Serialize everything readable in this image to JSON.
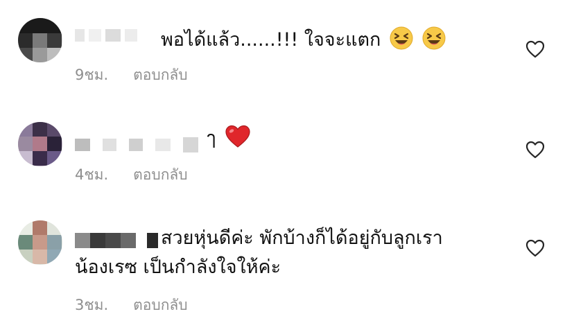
{
  "comments": [
    {
      "text": "พอได้แล้ว......!!! ใจจะแตก",
      "emoji": [
        "laughing-emoji",
        "laughing-emoji"
      ],
      "time": "9ชม.",
      "reply_label": "ตอบกลับ",
      "like_icon": "heart-outline-icon"
    },
    {
      "text": "ๅ",
      "emoji": [
        "red-heart-emoji"
      ],
      "time": "4ชม.",
      "reply_label": "ตอบกลับ",
      "like_icon": "heart-outline-icon"
    },
    {
      "text_line1": "สวยหุ่นดีค่ะ พักบ้างก็ได้อยู่กับลูกเรา",
      "text_line2": "น้องเรซ เป็นกำลังใจให้ค่ะ",
      "time": "3ชม.",
      "reply_label": "ตอบกลับ",
      "like_icon": "heart-outline-icon"
    }
  ],
  "colors": {
    "text": "#111111",
    "meta": "#8e8e8e",
    "emoji_yellow": "#f7c948",
    "heart_red": "#e0262b"
  }
}
